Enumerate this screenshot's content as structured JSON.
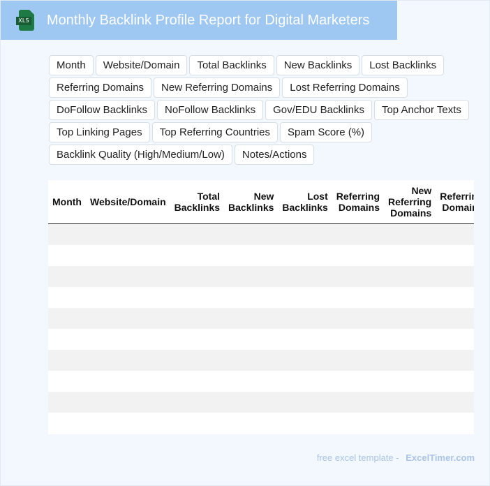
{
  "header": {
    "icon_label": "XLS",
    "title": "Monthly Backlink Profile Report for Digital Marketers"
  },
  "chips": [
    "Month",
    "Website/Domain",
    "Total Backlinks",
    "New Backlinks",
    "Lost Backlinks",
    "Referring Domains",
    "New Referring Domains",
    "Lost Referring Domains",
    "DoFollow Backlinks",
    "NoFollow Backlinks",
    "Gov/EDU Backlinks",
    "Top Anchor Texts",
    "Top Linking Pages",
    "Top Referring Countries",
    "Spam Score (%)",
    "Backlink Quality (High/Medium/Low)",
    "Notes/Actions"
  ],
  "table": {
    "columns": [
      "Month",
      "Website/Domain",
      "Total Backlinks",
      "New Backlinks",
      "Lost Backlinks",
      "Referring Domains",
      "New Referring Domains",
      "Referring Domains"
    ],
    "row_count": 10
  },
  "footer": {
    "prefix": "free excel template -",
    "brand": "ExcelTimer.com"
  },
  "colors": {
    "header_bg": "#9ec7f2",
    "page_bg": "#f3f8ff",
    "icon_green": "#1e7a45",
    "footer_text": "#aac3e6",
    "row_stripe": "#f2f2f2"
  }
}
